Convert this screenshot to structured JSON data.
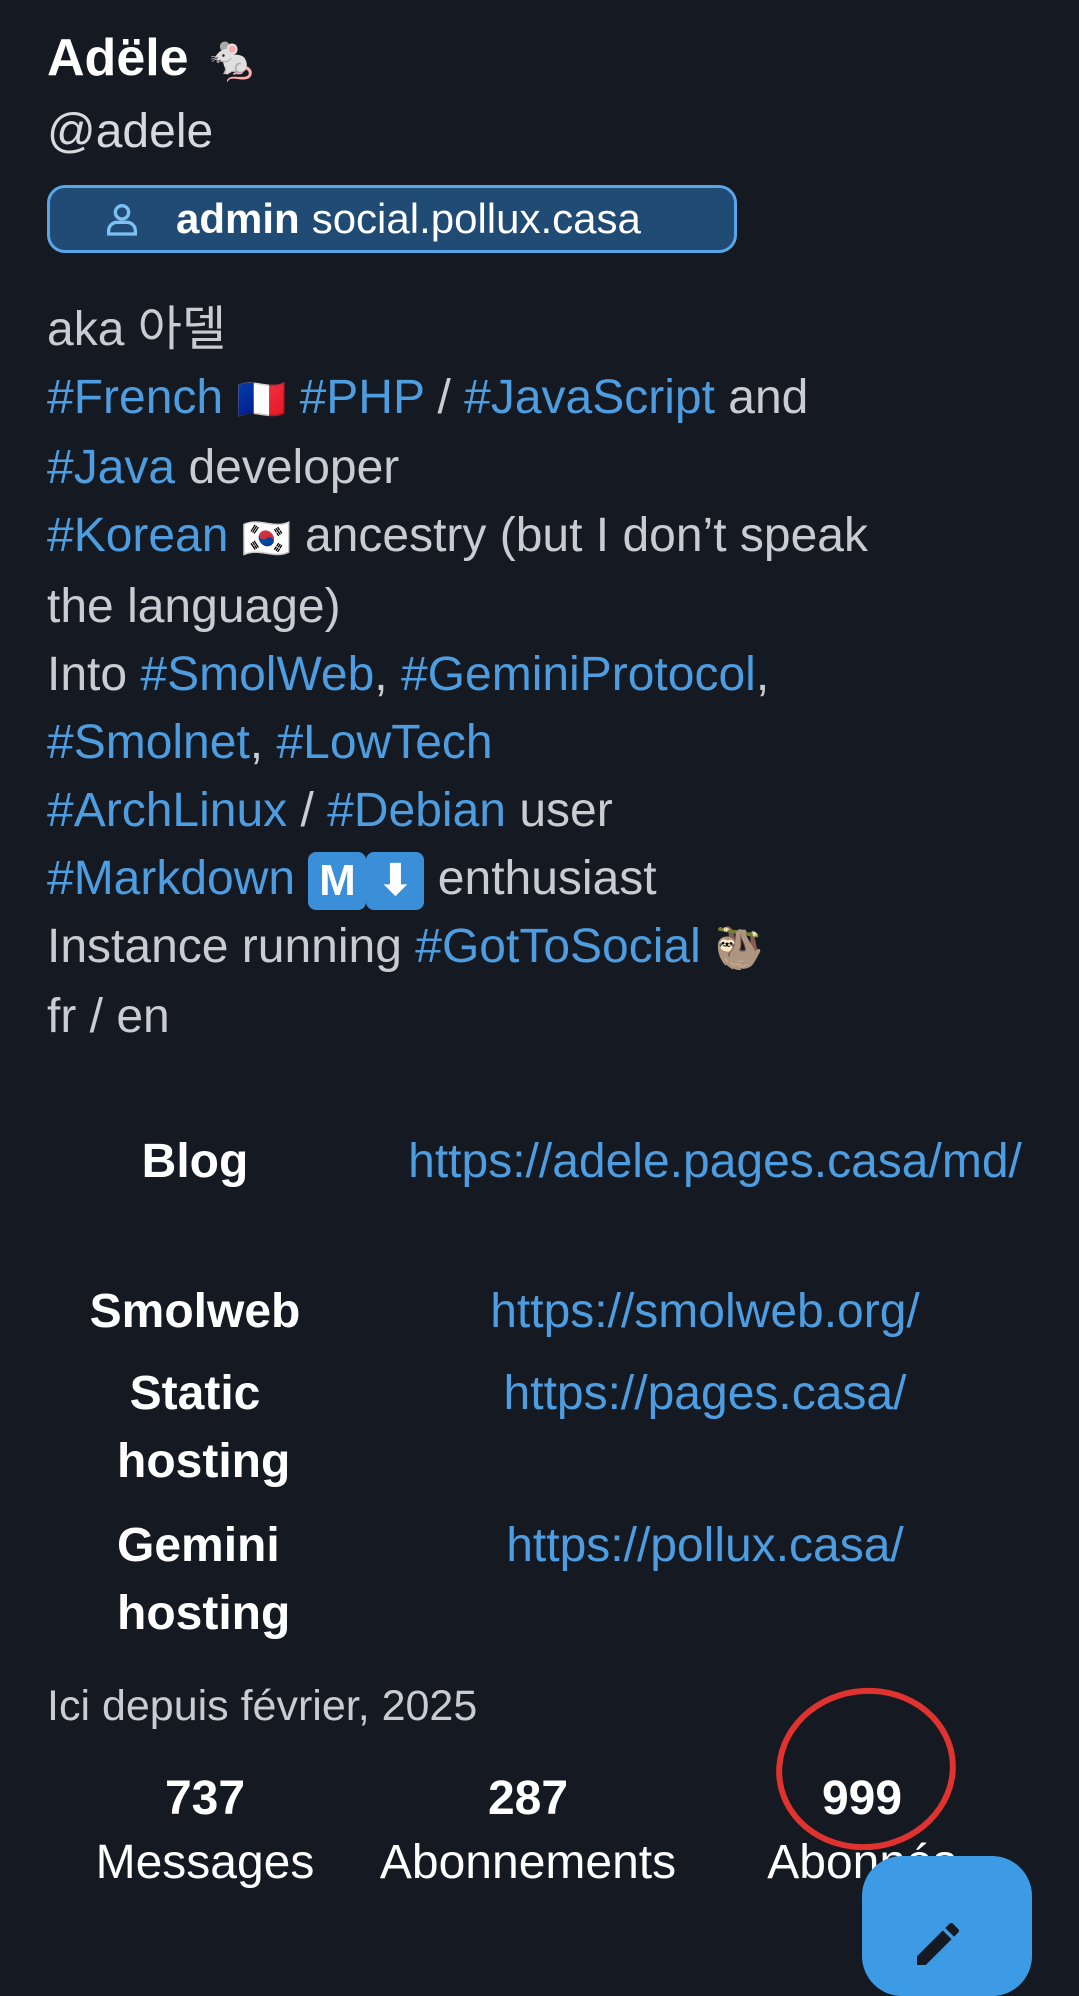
{
  "profile": {
    "display_name": "Adële",
    "name_emoji": "🐁",
    "handle": "@adele",
    "badge": {
      "role": "admin",
      "instance": "social.pollux.casa"
    }
  },
  "bio": {
    "l1": "aka 아델",
    "l2_tag1": "#French",
    "l2_flag": "🇫🇷",
    "l2_tag2": "#PHP",
    "l2_sep": "/",
    "l2_tag3": "#JavaScript",
    "l2_and": "and",
    "l3_tag": "#Java",
    "l3_text": "developer",
    "l4_tag": "#Korean",
    "l4_flag": "🇰🇷",
    "l4_text": "ancestry (but I don’t speak",
    "l5": "the language)",
    "l6_text": "Into",
    "l6_tag1": "#SmolWeb",
    "l6_tag2": "#GeminiProtocol",
    "l7_tag1": "#Smolnet",
    "l7_tag2": "#LowTech",
    "l8_tag1": "#ArchLinux",
    "l8_sep": "/",
    "l8_tag2": "#Debian",
    "l8_text": "user",
    "l9_tag": "#Markdown",
    "l9_box1": "M",
    "l9_box2": "⬇",
    "l9_text": "enthusiast",
    "l10_text": "Instance running",
    "l10_tag": "#GotToSocial",
    "l10_emoji": "🦥",
    "l11": "fr / en"
  },
  "fields": [
    {
      "key": "Blog",
      "value": "https://adele.pages.casa/md/"
    },
    {
      "key": "Smolweb",
      "value": "https://smolweb.org/"
    },
    {
      "key": "Static hosting",
      "value": "https://pages.casa/"
    },
    {
      "key": "Gemini hosting",
      "value": "https://pollux.casa/"
    }
  ],
  "since": "Ici depuis février, 2025",
  "stats": {
    "posts": {
      "count": "737",
      "label": "Messages"
    },
    "following": {
      "count": "287",
      "label": "Abonnements"
    },
    "followers": {
      "count": "999",
      "label": "Abonnés"
    }
  },
  "annotation_color": "#e0332f",
  "accent": "#4d9de0",
  "fab_icon": "pencil-icon"
}
